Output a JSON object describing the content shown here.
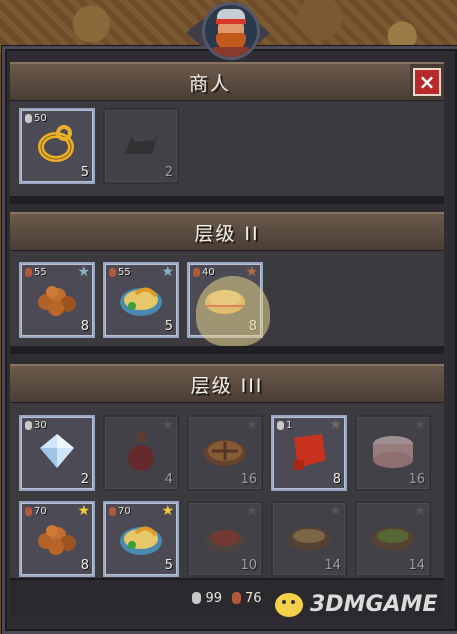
{
  "merchant": {
    "title": "商人",
    "close_icon": "×",
    "items": [
      {
        "icon": "gold-ring",
        "price": "50",
        "coin": "silver",
        "qty": "5",
        "state": "active"
      },
      {
        "icon": "iron-ingot",
        "price": "",
        "coin": "",
        "qty": "2",
        "state": "locked"
      }
    ]
  },
  "tier2": {
    "title": "层级 II",
    "items": [
      {
        "icon": "nuts",
        "price": "55",
        "coin": "copper",
        "qty": "8",
        "star": "silver",
        "state": "active"
      },
      {
        "icon": "fish-bowl",
        "price": "55",
        "coin": "copper",
        "qty": "5",
        "star": "silver",
        "state": "active"
      },
      {
        "icon": "stew",
        "price": "40",
        "coin": "copper",
        "qty": "8",
        "star": "bronze",
        "state": "active"
      }
    ]
  },
  "tier3": {
    "title": "层级 III",
    "items": [
      {
        "icon": "diamond",
        "price": "30",
        "coin": "silver",
        "qty": "2",
        "star": "",
        "state": "active"
      },
      {
        "icon": "potion",
        "price": "",
        "coin": "",
        "qty": "4",
        "star": "dim",
        "state": "locked"
      },
      {
        "icon": "pie",
        "price": "",
        "coin": "",
        "qty": "16",
        "star": "dim",
        "state": "locked"
      },
      {
        "icon": "red-cloth",
        "price": "1",
        "coin": "silver",
        "qty": "8",
        "star": "dim",
        "state": "active"
      },
      {
        "icon": "cake",
        "price": "",
        "coin": "",
        "qty": "16",
        "star": "dim",
        "state": "locked"
      },
      {
        "icon": "nuts",
        "price": "70",
        "coin": "copper",
        "qty": "8",
        "star": "gold",
        "state": "active"
      },
      {
        "icon": "fish-bowl",
        "price": "70",
        "coin": "copper",
        "qty": "5",
        "star": "gold",
        "state": "active"
      },
      {
        "icon": "meat-dish",
        "price": "",
        "coin": "",
        "qty": "10",
        "star": "dim",
        "state": "locked"
      },
      {
        "icon": "soup-bowl",
        "price": "",
        "coin": "",
        "qty": "14",
        "star": "dim",
        "state": "locked"
      },
      {
        "icon": "green-soup",
        "price": "",
        "coin": "",
        "qty": "14",
        "star": "dim",
        "state": "locked"
      }
    ]
  },
  "footer": {
    "silver": "99",
    "copper": "76"
  },
  "watermark": {
    "text": "3DMGAME"
  },
  "colors": {
    "panel": "#2f2d33",
    "header": "#5a4a3e",
    "close": "#b62a2a",
    "star_gold": "#f2cf2a",
    "star_silver": "#8fb0c8",
    "star_bronze": "#b56a3a"
  }
}
